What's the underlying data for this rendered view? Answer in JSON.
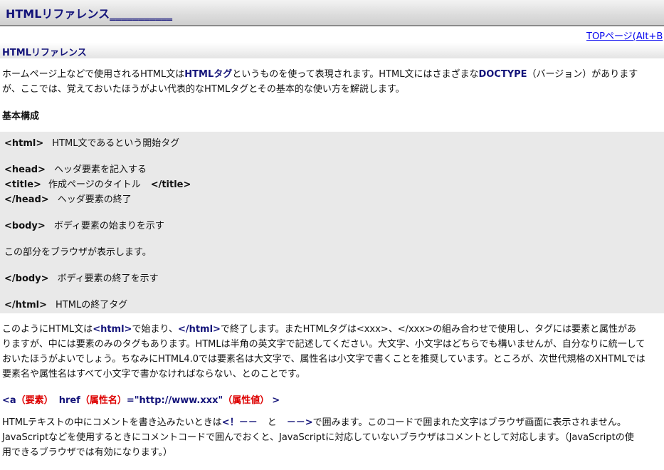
{
  "header": {
    "title": "HTMLリファレンス",
    "title_suffix": "___________"
  },
  "top_link": "TOPページ(Alt+B",
  "section_heading": "HTMLリファレンス",
  "intro": {
    "line1_a": "ホームページ上などで使用されるHTML文は",
    "line1_b": "HTMLタグ",
    "line1_c": "というものを使って表現されます。HTML文にはさまざまな",
    "line1_d": "DOCTYPE",
    "line1_e": "（バージョン）があります",
    "line2": "が、ここでは、覚えておいたほうがよい代表的なHTMLタグとその基本的な使い方を解説します。"
  },
  "basic_heading": "基本構成",
  "code": {
    "html_tag": "<html>",
    "html_desc": "HTML文であるという開始タグ",
    "head_tag": "<head>",
    "head_desc": "ヘッダ要素を記入する",
    "title_tag": "<title>",
    "title_desc": "作成ページのタイトル",
    "title_close": "</title>",
    "head_close": "</head>",
    "head_close_desc": "ヘッダ要素の終了",
    "body_tag": "<body>",
    "body_desc": "ボディ要素の始まりを示す",
    "browser_text": "この部分をブラウザが表示します。",
    "body_close": "</body>",
    "body_close_desc": "ボディ要素の終了を示す",
    "html_close": "</html>",
    "html_close_desc": "HTMLの終了タグ"
  },
  "para2": {
    "l1_a": "このようにHTML文は",
    "l1_b": "<html>",
    "l1_c": "で始まり、",
    "l1_d": "</html>",
    "l1_e": "で終了します。またHTMLタグは<xxx>、</xxx>の組み合わせで使用し、タグには要素と属性があ",
    "l2": "りますが、中には要素のみのタグもあります。HTMLは半角の英文字で記述してください。大文字、小文字はどちらでも構いませんが、自分なりに統一して",
    "l3": "おいたほうがよいでしょう。ちなみにHTML4.0では要素名は大文字で、属性名は小文字で書くことを推奨しています。ところが、次世代規格のXHTMLでは",
    "l4": "要素名や属性名はすべて小文字で書かなければならない、とのことです。"
  },
  "example": {
    "a": "<a",
    "element": "（要素）",
    "href": "href",
    "attr_name": "（属性名）",
    "value": "=\"http://www.xxx\"",
    "attr_value": "（属性値）",
    "close": ">"
  },
  "para3": {
    "l1_a": "HTMLテキストの中にコメントを書き込みたいときは",
    "l1_b": "<！－－",
    "l1_c": "と",
    "l1_d": "－－>",
    "l1_e": "で囲みます。このコードで囲まれた文字はブラウザ画面に表示されません。",
    "l2": "JavaScriptなどを使用するときにコメントコードで囲んでおくと、JavaScriptに対応していないブラウザはコメントとして対応します。（JavaScriptの使",
    "l3": "用できるブラウザでは有効になります。）"
  }
}
